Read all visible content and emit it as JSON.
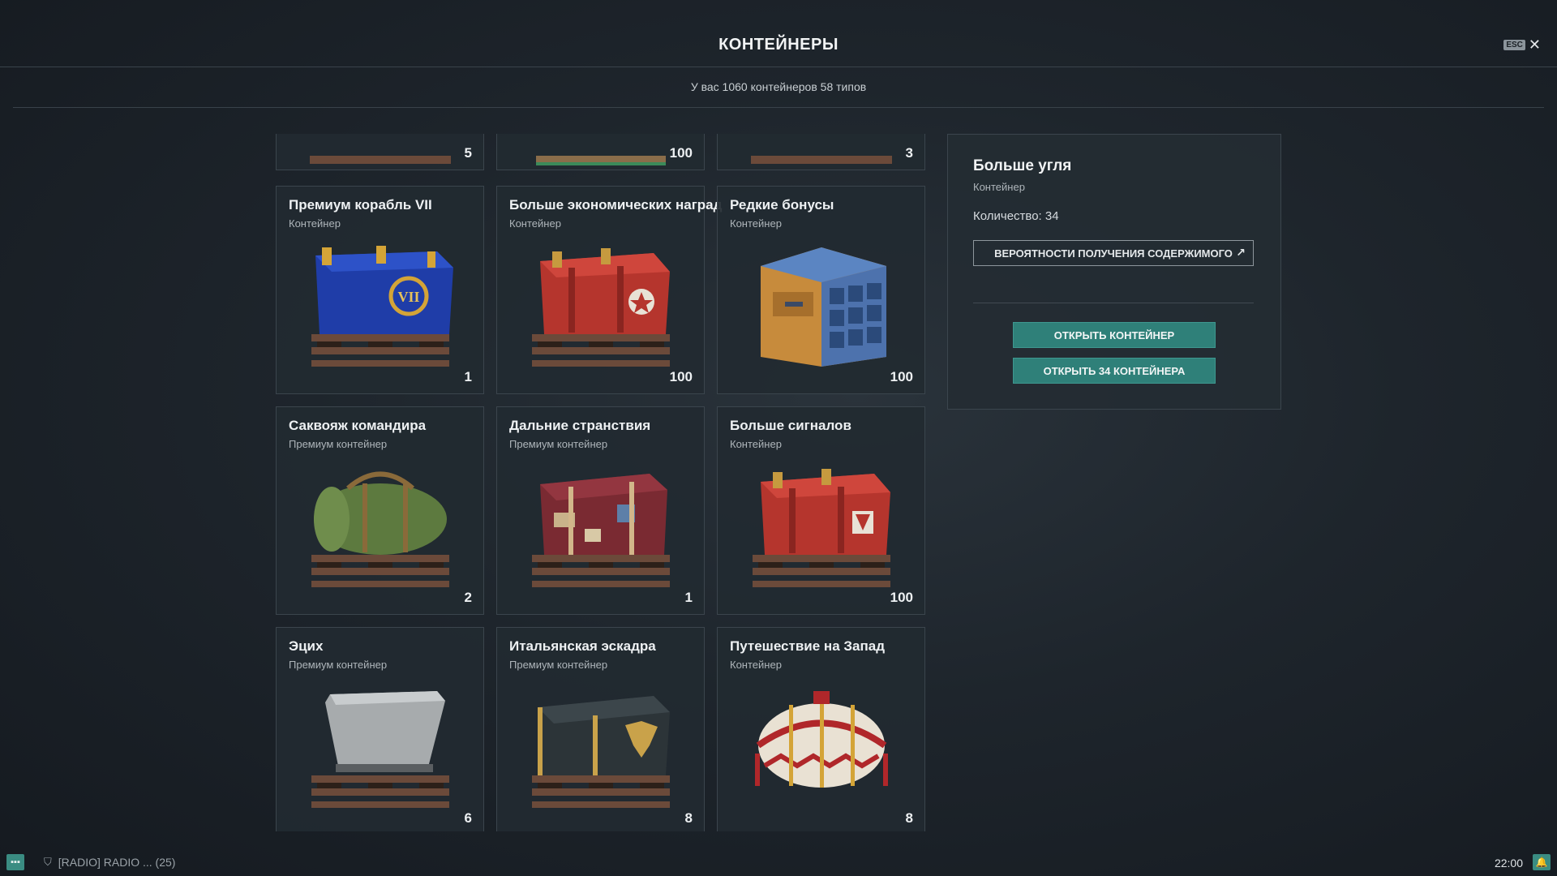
{
  "header": {
    "title": "КОНТЕЙНЕРЫ",
    "esc_label": "ESC",
    "close_icon": "close-icon"
  },
  "summary": "У вас 1060 контейнеров 58 типов",
  "top_row_counts": [
    "5",
    "100",
    "3"
  ],
  "cards": [
    {
      "name": "Премиум корабль VII",
      "type": "Контейнер",
      "count": "1",
      "icon": "blue-crate-icon"
    },
    {
      "name": "Больше экономических наград",
      "type": "Контейнер",
      "count": "100",
      "icon": "red-crate-icon"
    },
    {
      "name": "Редкие бонусы",
      "type": "Контейнер",
      "count": "100",
      "icon": "drawer-cabinet-icon"
    },
    {
      "name": "Саквояж командира",
      "type": "Премиум контейнер",
      "count": "2",
      "icon": "duffel-bag-icon"
    },
    {
      "name": "Дальние странствия",
      "type": "Премиум контейнер",
      "count": "1",
      "icon": "suitcase-icon"
    },
    {
      "name": "Больше сигналов",
      "type": "Контейнер",
      "count": "100",
      "icon": "red-crate-icon"
    },
    {
      "name": "Эцих",
      "type": "Премиум контейнер",
      "count": "6",
      "icon": "metal-tub-icon"
    },
    {
      "name": "Итальянская эскадра",
      "type": "Премиум контейнер",
      "count": "8",
      "icon": "dark-chest-icon"
    },
    {
      "name": "Путешествие на Запад",
      "type": "Контейнер",
      "count": "8",
      "icon": "lantern-drum-icon"
    }
  ],
  "panel": {
    "name": "Больше угля",
    "type": "Контейнер",
    "quantity": "Количество: 34",
    "probabilities_button": "ВЕРОЯТНОСТИ ПОЛУЧЕНИЯ СОДЕРЖИМОГО",
    "open_button": "ОТКРЫТЬ КОНТЕЙНЕР",
    "open_all_button": "ОТКРЫТЬ 34 КОНТЕЙНЕРА"
  },
  "footer": {
    "radio": "[RADIO] RADIO ... (25)",
    "time": "22:00"
  },
  "colors": {
    "accent": "#2f8079",
    "card_bg": "#222a31",
    "panel_bg": "#242c33"
  }
}
